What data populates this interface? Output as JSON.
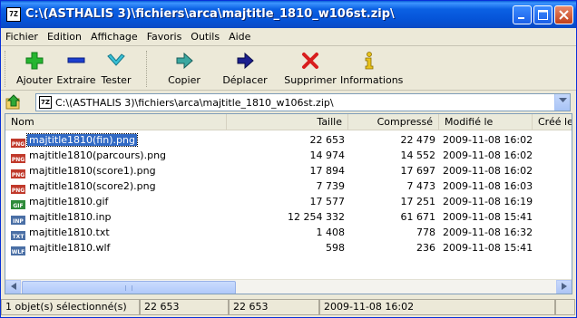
{
  "window": {
    "title": "C:\\(ASTHALIS 3)\\fichiers\\arca\\majtitle_1810_w106st.zip\\",
    "app_icon": "7Z",
    "buttons": [
      "minimize",
      "maximize",
      "close"
    ]
  },
  "menu": [
    "Fichier",
    "Edition",
    "Affichage",
    "Favoris",
    "Outils",
    "Aide"
  ],
  "toolbar": {
    "add": "Ajouter",
    "extract": "Extraire",
    "test": "Tester",
    "copy": "Copier",
    "move": "Déplacer",
    "delete": "Supprimer",
    "info": "Informations"
  },
  "address": {
    "path": "C:\\(ASTHALIS 3)\\fichiers\\arca\\majtitle_1810_w106st.zip\\"
  },
  "columns": {
    "name": "Nom",
    "size": "Taille",
    "packed": "Compressé",
    "modified": "Modifié le",
    "created": "Créé le"
  },
  "files": [
    {
      "name": "majtitle1810(fin).png",
      "type": "PNG",
      "size": "22 653",
      "packed": "22 479",
      "modified": "2009-11-08 16:02",
      "selected": true
    },
    {
      "name": "majtitle1810(parcours).png",
      "type": "PNG",
      "size": "14 974",
      "packed": "14 552",
      "modified": "2009-11-08 16:02",
      "selected": false
    },
    {
      "name": "majtitle1810(score1).png",
      "type": "PNG",
      "size": "17 894",
      "packed": "17 697",
      "modified": "2009-11-08 16:02",
      "selected": false
    },
    {
      "name": "majtitle1810(score2).png",
      "type": "PNG",
      "size": "7 739",
      "packed": "7 473",
      "modified": "2009-11-08 16:03",
      "selected": false
    },
    {
      "name": "majtitle1810.gif",
      "type": "GIF",
      "size": "17 577",
      "packed": "17 251",
      "modified": "2009-11-08 16:19",
      "selected": false
    },
    {
      "name": "majtitle1810.inp",
      "type": "INP",
      "size": "12 254 332",
      "packed": "61 671",
      "modified": "2009-11-08 15:41",
      "selected": false
    },
    {
      "name": "majtitle1810.txt",
      "type": "TXT",
      "size": "1 408",
      "packed": "778",
      "modified": "2009-11-08 16:32",
      "selected": false
    },
    {
      "name": "majtitle1810.wlf",
      "type": "WLF",
      "size": "598",
      "packed": "236",
      "modified": "2009-11-08 15:41",
      "selected": false
    }
  ],
  "status": {
    "selection": "1 objet(s) sélectionné(s)",
    "size": "22 653",
    "packed": "22 653",
    "modified": "2009-11-08 16:02"
  },
  "colors": {
    "title_blue": "#0553d7",
    "selection_blue": "#316ac5",
    "png_icon": "#c0392b",
    "gif_icon": "#2e8b3a",
    "doc_icon": "#4a6fa5"
  }
}
